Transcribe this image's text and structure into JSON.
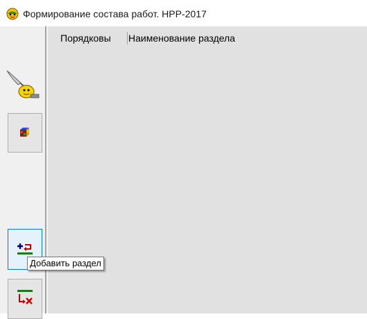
{
  "window": {
    "title": "Формирование  состава  работ.  НРР-2017",
    "icon": "app-icon"
  },
  "toolbar": {
    "buttons": [
      {
        "name": "quill-bird-button",
        "icon": "quill-bird-icon"
      },
      {
        "name": "cube-button",
        "icon": "cube-icon"
      },
      {
        "name": "add-section-button",
        "icon": "add-section-icon"
      },
      {
        "name": "delete-section-button",
        "icon": "delete-section-icon"
      }
    ]
  },
  "grid": {
    "columns": [
      "Порядковы",
      "Наименование  раздела"
    ],
    "rows": []
  },
  "tooltip": {
    "text": "Добавить  раздел"
  },
  "colors": {
    "hover_border": "#0078d7",
    "hover_fill": "#e5f1fb",
    "grid_background": "#e1e1e1"
  }
}
